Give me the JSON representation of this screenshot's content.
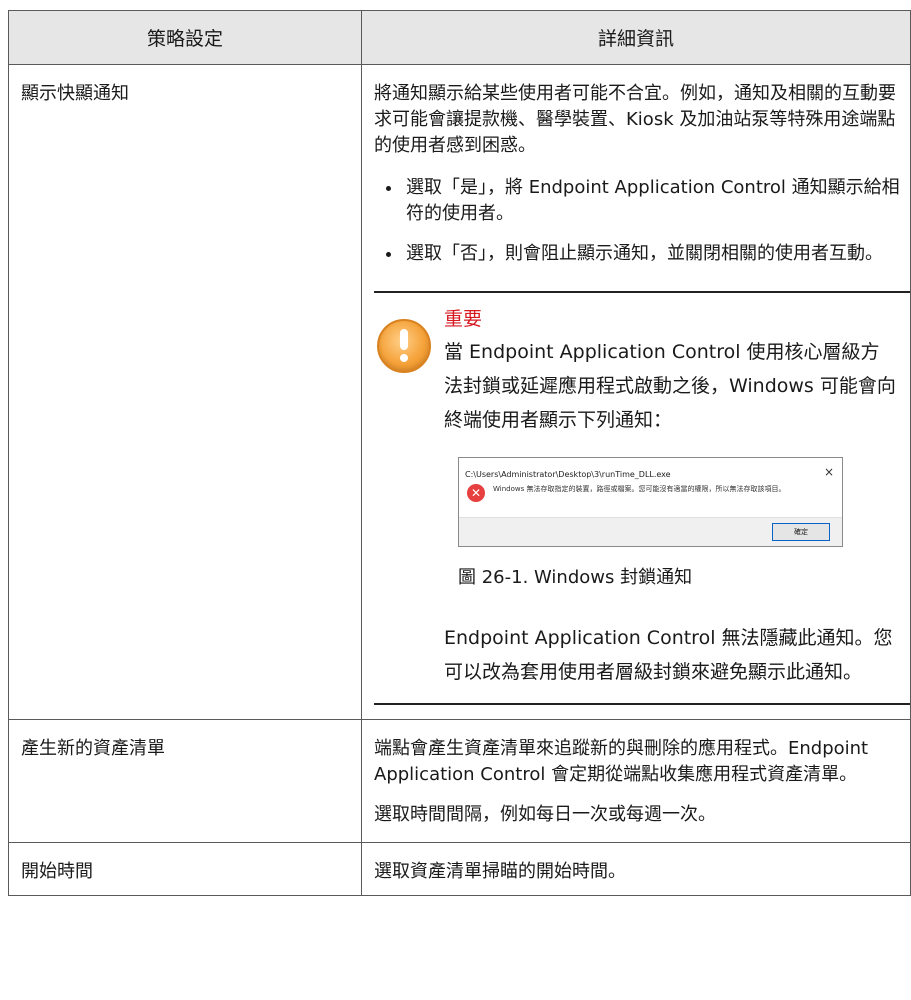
{
  "header": {
    "col1": "策略設定",
    "col2": "詳細資訊"
  },
  "rows": [
    {
      "setting": "顯示快顯通知",
      "intro": "將通知顯示給某些使用者可能不合宜。例如，通知及相關的互動要求可能會讓提款機、醫學裝置、Kiosk 及加油站泵等特殊用途端點的使用者感到困惑。",
      "bullets": [
        "選取「是」，將 Endpoint Application Control 通知顯示給相符的使用者。",
        "選取「否」，則會阻止顯示通知，並關閉相關的使用者互動。"
      ],
      "note": {
        "icon": "warning-icon",
        "title": "重要",
        "text": "當 Endpoint Application Control 使用核心層級方法封鎖或延遲應用程式啟動之後，Windows 可能會向終端使用者顯示下列通知：",
        "dialog": {
          "title": "C:\\Users\\Administrator\\Desktop\\3\\runTime_DLL.exe",
          "close": "×",
          "message": "Windows 無法存取指定的裝置，路徑或檔案。您可能沒有適當的權限，所以無法存取該項目。",
          "ok": "確定"
        },
        "caption": "圖 26-1. Windows 封鎖通知",
        "text2": "Endpoint Application Control 無法隱藏此通知。您可以改為套用使用者層級封鎖來避免顯示此通知。"
      }
    },
    {
      "setting": "產生新的資產清單",
      "p1": "端點會產生資產清單來追蹤新的與刪除的應用程式。Endpoint Application Control 會定期從端點收集應用程式資產清單。",
      "p2": "選取時間間隔，例如每日一次或每週一次。"
    },
    {
      "setting": "開始時間",
      "p1": "選取資產清單掃瞄的開始時間。"
    }
  ]
}
